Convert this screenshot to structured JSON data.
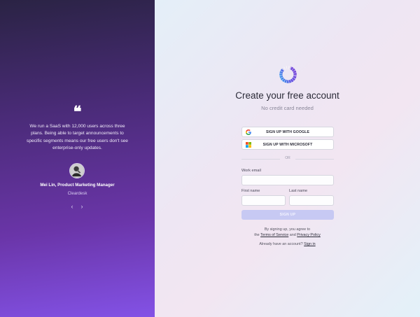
{
  "testimonial": {
    "quote_mark": "❝",
    "quote": "We run a SaaS with 12,000 users across three plans. Being able to target announcements to specific segments means our free users don't see enterprise-only updates.",
    "author": "Mei Lin, Product Marketing Manager",
    "company": "Cleardesk",
    "prev": "‹",
    "next": "›"
  },
  "signup": {
    "title": "Create your free account",
    "subtitle": "No credit card needed",
    "google_label": "SIGN UP WITH GOOGLE",
    "microsoft_label": "SIGN UP WITH MICROSOFT",
    "divider": "OR",
    "email_label": "Work email",
    "email_value": "",
    "first_name_label": "First name",
    "first_name_value": "",
    "last_name_label": "Last name",
    "last_name_value": "",
    "submit_label": "SIGN UP",
    "legal_prefix": "By signing up, you agree to",
    "legal_the": "the",
    "terms_link": "Terms of Service",
    "legal_and": "and",
    "privacy_link": "Privacy Policy",
    "account_prompt": "Already have an account?",
    "signin_link": "Sign in"
  },
  "colors": {
    "accent": "#5b4be0",
    "panel_top": "#2a2344",
    "panel_bottom": "#8352e6",
    "submit_disabled": "#c7c9f3"
  },
  "icons": {
    "logo": "logo-icon",
    "google": "google-icon",
    "microsoft": "microsoft-icon",
    "quote": "quote-icon"
  }
}
